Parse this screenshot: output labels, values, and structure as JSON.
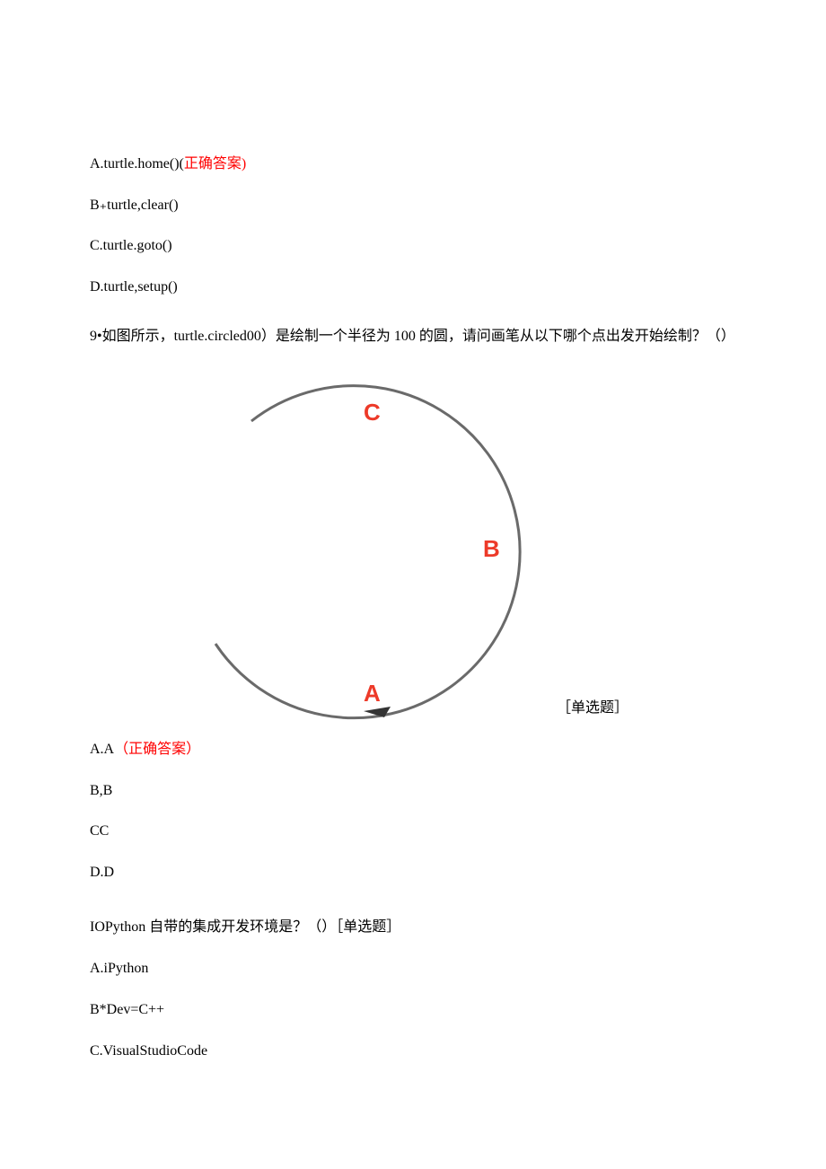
{
  "q8": {
    "options": {
      "a_text": "A.turtle.home()(",
      "a_correct": "正确答案)",
      "b": "B₊turtle,clear()",
      "c": "C.turtle.goto()",
      "d": "D.turtle,setup()"
    }
  },
  "q9": {
    "prompt": "9•如图所示，turtle.circled00）是绘制一个半径为 100 的圆，请问画笔从以下哪个点出发开始绘制？（）",
    "labels": {
      "a": "A",
      "b": "B",
      "c": "C"
    },
    "tag": "［单选题］",
    "options": {
      "a_text": "A.A",
      "a_correct": "（正确答案）",
      "b": "B,B",
      "c": "CC",
      "d": "D.D"
    }
  },
  "q10": {
    "prompt": "IOPython 自带的集成开发环境是？（）［单选题］",
    "options": {
      "a": "A.iPython",
      "b": "B*Dev=C++",
      "c": "C.VisualStudioCode"
    }
  }
}
